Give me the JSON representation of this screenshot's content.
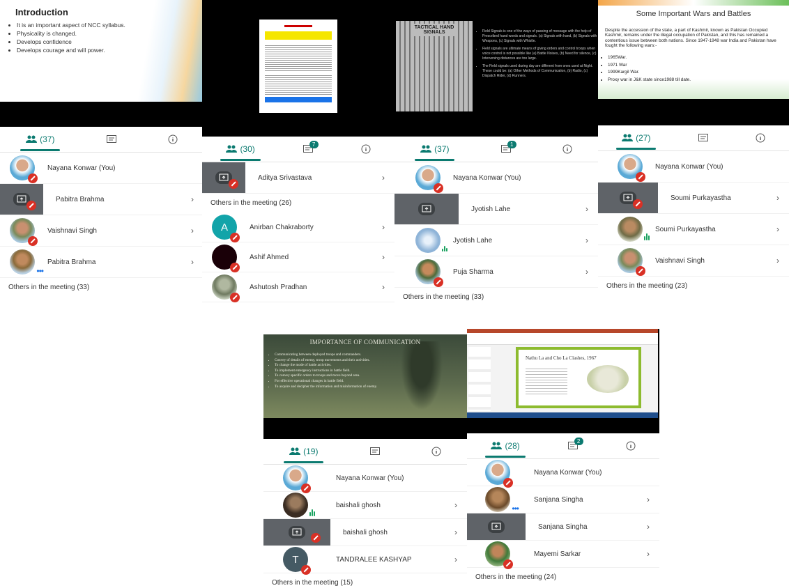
{
  "panels": [
    {
      "slide": {
        "title": "Introduction",
        "bullets": [
          "It is an important aspect of NCC syllabus.",
          "Physicality is changed.",
          "Develops confidence",
          "Develops courage and will power."
        ]
      },
      "tabs": {
        "people_count": "(37)",
        "chat_badge": ""
      },
      "rows": [
        {
          "name": "Nayana Konwar (You)",
          "type": "avatar",
          "status": "muted",
          "chevron": ""
        },
        {
          "name": "Pabitra Brahma",
          "type": "share",
          "status": "muted",
          "chevron": "›"
        },
        {
          "name": "Vaishnavi Singh",
          "type": "avatar",
          "status": "muted",
          "chevron": "›"
        },
        {
          "name": "Pabitra Brahma",
          "type": "avatar",
          "status": "more",
          "chevron": "›"
        }
      ],
      "others": "Others in the meeting (33)"
    },
    {
      "slide": {
        "title": "",
        "bullets": []
      },
      "tabs": {
        "people_count": "(30)",
        "chat_badge": "7"
      },
      "rows": [
        {
          "name": "Aditya Srivastava",
          "type": "share",
          "status": "muted",
          "chevron": "›"
        }
      ],
      "others": "Others in the meeting (26)",
      "rows2": [
        {
          "name": "Anirban Chakraborty",
          "type": "letter",
          "letter": "A",
          "status": "muted",
          "chevron": "›"
        },
        {
          "name": "Ashif Ahmed",
          "type": "avatar",
          "status": "muted",
          "chevron": "›"
        },
        {
          "name": "Ashutosh Pradhan",
          "type": "avatar",
          "status": "muted",
          "chevron": "›"
        }
      ]
    },
    {
      "slide": {
        "title": "TACTICAL HAND SIGNALS",
        "bullets": [
          "Field Signals is one of the ways of passing of message with the help of Prescribed hand words and signals. (a) Signals with hand, (b) Signals with Weapons, (c) Signals with Whistle.",
          "Field signals are ultimate means of giving orders and control troops when voice control is not possible like (a) Battle Noises, (b) Need for silence, (c) Intervening distances are too large.",
          "The Field signals used during day are different from ones used at Night. These could be: (a) Other Methods of Communication, (b) Radio, (c) Dispatch Rider, (d) Runners."
        ]
      },
      "tabs": {
        "people_count": "(37)",
        "chat_badge": "1"
      },
      "rows": [
        {
          "name": "Nayana Konwar (You)",
          "type": "avatar",
          "status": "muted",
          "chevron": ""
        },
        {
          "name": "Jyotish Lahe",
          "type": "share",
          "status": "muted",
          "chevron": "›"
        },
        {
          "name": "Jyotish Lahe",
          "type": "avatar",
          "status": "speaking",
          "chevron": "›"
        },
        {
          "name": "Puja Sharma",
          "type": "avatar",
          "status": "muted",
          "chevron": "›"
        }
      ],
      "others": "Others in the meeting (33)"
    },
    {
      "slide": {
        "title": "Some Important Wars and Battles",
        "body": "Despite the accession of the state, a part of Kashmir, known as Pakistan Occupied Kashmir, remains under the illegal occupation of Pakistan, and this has remained a contentious issue between both nations. Since 1947-1948 war India and Pakistan have fought the following wars:-",
        "bullets": [
          "1965War.",
          "1971 War",
          "1999Kargil War.",
          "Proxy war in J&K state since1988 till date."
        ]
      },
      "tabs": {
        "people_count": "(27)",
        "chat_badge": ""
      },
      "rows": [
        {
          "name": "Nayana Konwar (You)",
          "type": "avatar",
          "status": "muted",
          "chevron": ""
        },
        {
          "name": "Soumi Purkayastha",
          "type": "share",
          "status": "muted",
          "chevron": "›"
        },
        {
          "name": "Soumi Purkayastha",
          "type": "avatar",
          "status": "speaking",
          "chevron": "›"
        },
        {
          "name": "Vaishnavi Singh",
          "type": "avatar",
          "status": "muted",
          "chevron": "›"
        }
      ],
      "others": "Others in the meeting (23)"
    },
    {
      "slide": {
        "title": "IMPORTANCE OF COMMUNICATION",
        "bullets": [
          "Communicating between deployed troops and commanders.",
          "Convey of details of enemy, troop movements and their activities.",
          "To change the mode of battle activities.",
          "To implement emergency instructions in battle field.",
          "To convey specific orders to troops and move beyond area.",
          "For effective operational changes in battle field.",
          "To acquire and decipher the information and misinformation of enemy."
        ]
      },
      "tabs": {
        "people_count": "(19)",
        "chat_badge": ""
      },
      "rows": [
        {
          "name": "Nayana Konwar (You)",
          "type": "avatar",
          "status": "muted",
          "chevron": ""
        },
        {
          "name": "baishali ghosh",
          "type": "avatar",
          "status": "speaking",
          "chevron": "›"
        },
        {
          "name": "baishali ghosh",
          "type": "share",
          "status": "muted",
          "chevron": "›"
        },
        {
          "name": "TANDRALEE KASHYAP",
          "type": "letter",
          "letter": "T",
          "status": "muted",
          "chevron": "›"
        }
      ],
      "others": "Others in the meeting (15)"
    },
    {
      "slide": {
        "title": "Nathu La and Cho La Clashes, 1967",
        "bullets": []
      },
      "tabs": {
        "people_count": "(28)",
        "chat_badge": "2"
      },
      "rows": [
        {
          "name": "Nayana Konwar (You)",
          "type": "avatar",
          "status": "muted",
          "chevron": ""
        },
        {
          "name": "Sanjana Singha",
          "type": "avatar",
          "status": "more",
          "chevron": "›"
        },
        {
          "name": "Sanjana Singha",
          "type": "share",
          "status": "muted",
          "chevron": "›"
        },
        {
          "name": "Mayemi Sarkar",
          "type": "avatar",
          "status": "muted",
          "chevron": "›"
        }
      ],
      "others": "Others in the meeting (24)"
    }
  ],
  "colors": {
    "accent": "#0b7a70",
    "mute": "#d93025",
    "speak": "#1aa260"
  }
}
